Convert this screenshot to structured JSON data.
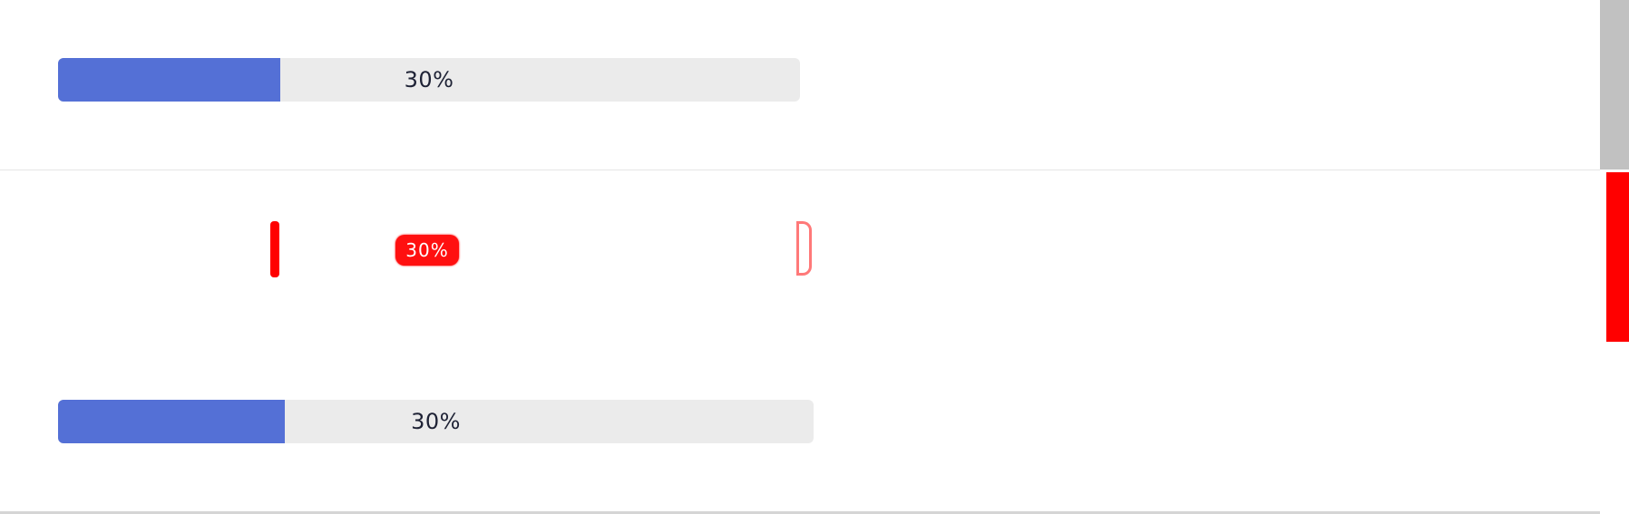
{
  "progress_bars": [
    {
      "label": "30%",
      "value": 0.3
    },
    {
      "label": "30%",
      "value": 0.3
    }
  ],
  "artifact": {
    "text": "30%"
  },
  "colors": {
    "fill": "#5470d6",
    "track": "#ebebeb",
    "text": "#1e2235",
    "artifact": "#ff0000",
    "scrollbar_thumb": "#c1c1c1"
  }
}
